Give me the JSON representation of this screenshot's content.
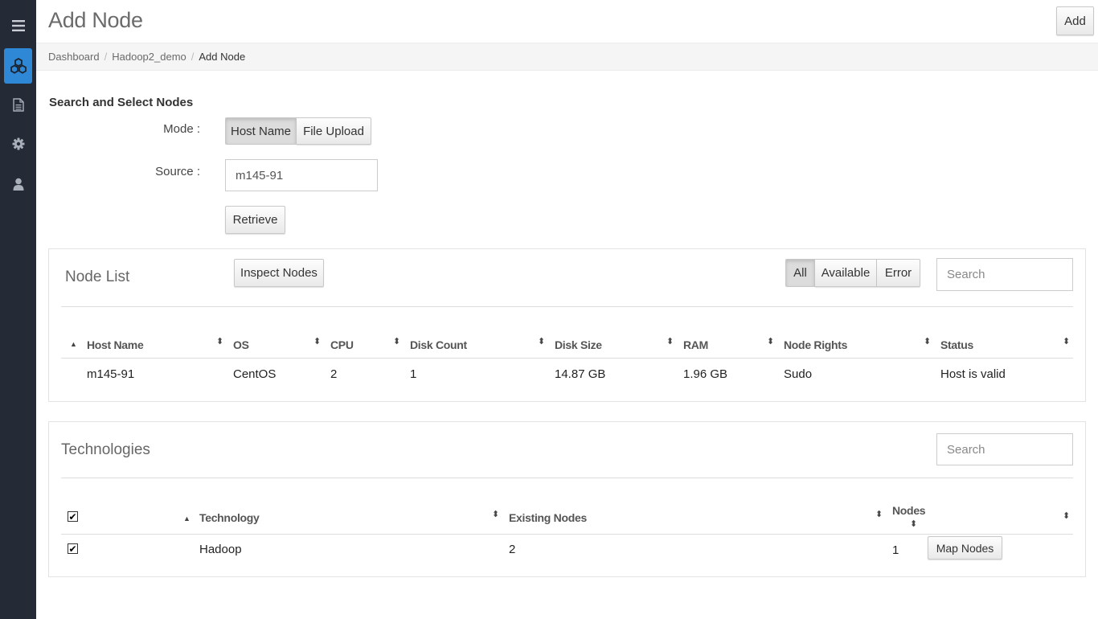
{
  "sidebar": {
    "items": [
      {
        "icon": "menu-icon"
      },
      {
        "icon": "cluster-icon",
        "active": true
      },
      {
        "icon": "document-icon"
      },
      {
        "icon": "gear-icon"
      },
      {
        "icon": "user-icon"
      }
    ]
  },
  "header": {
    "title": "Add Node",
    "add_label": "Add"
  },
  "breadcrumb": {
    "items": [
      "Dashboard",
      "Hadoop2_demo"
    ],
    "current": "Add Node"
  },
  "search_section": {
    "title": "Search and Select Nodes",
    "mode_label": "Mode :",
    "mode_options": [
      "Host Name",
      "File Upload"
    ],
    "mode_selected": "Host Name",
    "source_label": "Source :",
    "source_value": "m145-91",
    "retrieve_label": "Retrieve"
  },
  "node_list": {
    "title": "Node List",
    "inspect_label": "Inspect Nodes",
    "filters": [
      "All",
      "Available",
      "Error"
    ],
    "filter_selected": "All",
    "search_placeholder": "Search",
    "columns": [
      "Host Name",
      "OS",
      "CPU",
      "Disk Count",
      "Disk Size",
      "RAM",
      "Node Rights",
      "Status"
    ],
    "rows": [
      [
        "m145-91",
        "CentOS",
        "2",
        "1",
        "14.87 GB",
        "1.96 GB",
        "Sudo",
        "Host is valid"
      ]
    ]
  },
  "technologies": {
    "title": "Technologies",
    "search_placeholder": "Search",
    "columns": [
      "Technology",
      "Existing Nodes",
      "Nodes"
    ],
    "rows": [
      {
        "checked": true,
        "technology": "Hadoop",
        "existing_nodes": "2",
        "nodes": "1",
        "action": "Map Nodes"
      }
    ]
  },
  "colors": {
    "sidebar_bg": "#252b36",
    "active_accent": "#2f88d6",
    "breadcrumb_bg": "#f5f5f5"
  }
}
